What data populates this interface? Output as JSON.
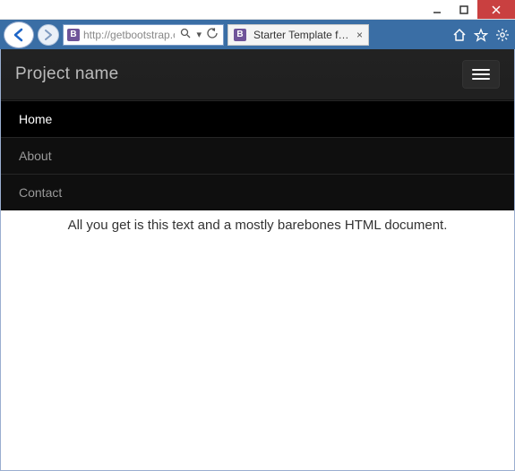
{
  "window": {
    "tab_title": "Starter Template for B...",
    "url_display": "http://getbootstrap.c..."
  },
  "navbar": {
    "brand": "Project name",
    "items": [
      {
        "label": "Home",
        "active": true
      },
      {
        "label": "About",
        "active": false
      },
      {
        "label": "Contact",
        "active": false
      }
    ]
  },
  "content": {
    "lead": "All you get is this text and a mostly barebones HTML document."
  }
}
